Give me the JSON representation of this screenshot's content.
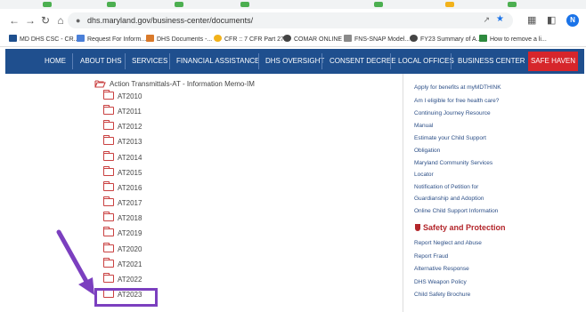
{
  "browser": {
    "url": "dhs.maryland.gov/business-center/documents/",
    "avatar_letter": "N",
    "bookmarks": [
      {
        "label": "MD DHS CSC - CR...",
        "color": "#1e4f8e"
      },
      {
        "label": "Request For Inform...",
        "color": "#4a7fd8"
      },
      {
        "label": "DHS Documents -...",
        "color": "#d97a2b"
      },
      {
        "label": "CFR :: 7 CFR Part 27...",
        "color": "#f2b21b"
      },
      {
        "label": "COMAR ONLINE",
        "color": "#444444"
      },
      {
        "label": "FNS-SNAP Model...",
        "color": "#8a8a8a"
      },
      {
        "label": "FY23 Summary of A...",
        "color": "#444444"
      },
      {
        "label": "How to remove a li...",
        "color": "#2d8a3e"
      }
    ]
  },
  "site_nav": {
    "items": [
      "HOME",
      "ABOUT DHS",
      "SERVICES",
      "FINANCIAL ASSISTANCE",
      "DHS OVERSIGHT",
      "CONSENT DECREE",
      "LOCAL OFFICES",
      "BUSINESS CENTER"
    ],
    "safe_haven": "SAFE HAVEN"
  },
  "folders": {
    "parent": "Action Transmittals-AT - Information Memo-IM",
    "items": [
      "AT2010",
      "AT2011",
      "AT2012",
      "AT2013",
      "AT2014",
      "AT2015",
      "AT2016",
      "AT2017",
      "AT2018",
      "AT2019",
      "AT2020",
      "AT2021",
      "AT2022",
      "AT2023"
    ],
    "highlighted": "AT2023"
  },
  "sidebar": {
    "links": [
      "Apply for benefits at myMDTHINK",
      "Am I eligible for free health care?",
      "Continuing Journey Resource",
      "Manual",
      "Estimate your Child Support",
      "Obligation",
      "Maryland Community Services",
      "Locator",
      "Notification of Petition for",
      "Guardianship and Adoption",
      "Online Child Support Information"
    ],
    "safety_heading": "Safety and Protection",
    "safety_links": [
      "Report Neglect and Abuse",
      "Report Fraud",
      "Alternative Response",
      "DHS Weapon Policy",
      "Child Safety Brochure"
    ]
  },
  "colors": {
    "nav_bg": "#1f4f8e",
    "safe_haven": "#d6262b",
    "highlight_box": "#7b3fbf",
    "arrow": "#7b3fbf",
    "folder_icon": "#c94040"
  }
}
